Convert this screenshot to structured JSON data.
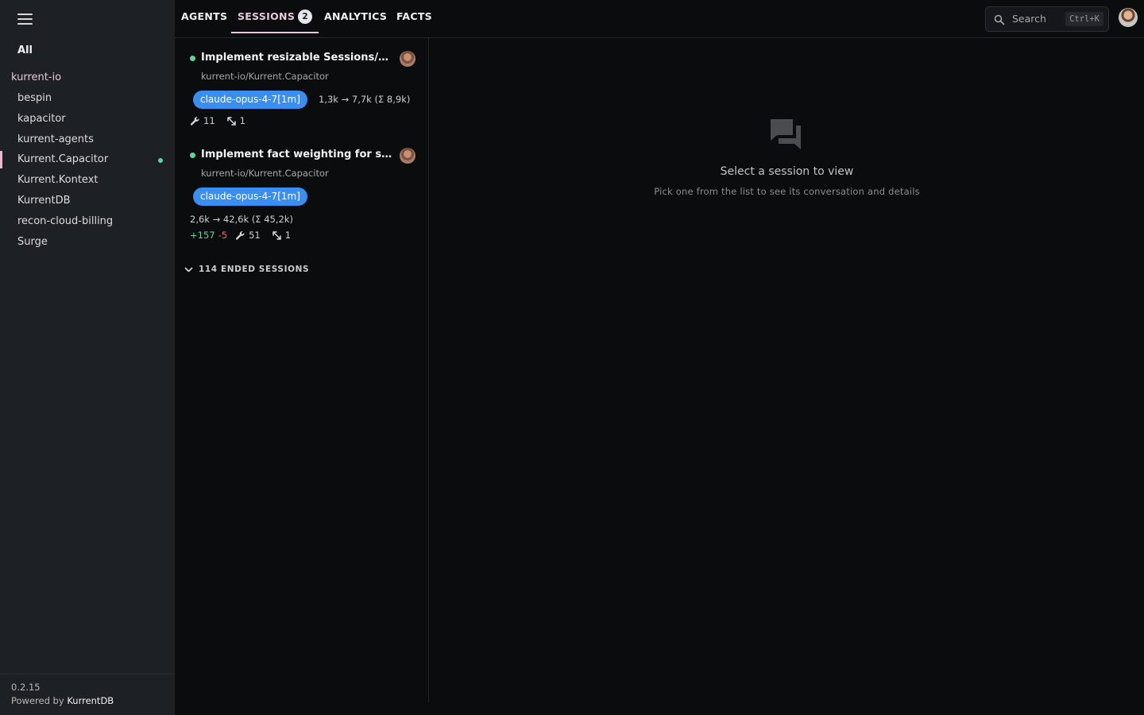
{
  "sidebar": {
    "all_label": "All",
    "org": "kurrent-io",
    "repos": [
      {
        "name": "bespin",
        "active": false,
        "dot": false
      },
      {
        "name": "kapacitor",
        "active": false,
        "dot": false
      },
      {
        "name": "kurrent-agents",
        "active": false,
        "dot": false
      },
      {
        "name": "Kurrent.Capacitor",
        "active": true,
        "dot": true
      },
      {
        "name": "Kurrent.Kontext",
        "active": false,
        "dot": false
      },
      {
        "name": "KurrentDB",
        "active": false,
        "dot": false
      },
      {
        "name": "recon-cloud-billing",
        "active": false,
        "dot": false
      },
      {
        "name": "Surge",
        "active": false,
        "dot": false
      }
    ],
    "version": "0.2.15",
    "powered_by": "Powered by",
    "powered_brand": "KurrentDB"
  },
  "tabs": {
    "agents": "AGENTS",
    "sessions": "SESSIONS",
    "sessions_count": "2",
    "analytics": "ANALYTICS",
    "facts": "FACTS"
  },
  "search": {
    "placeholder": "Search",
    "shortcut": "Ctrl+K"
  },
  "sessions": [
    {
      "title": "Implement resizable Sessions/Ag...",
      "repo": "kurrent-io/Kurrent.Capacitor",
      "model": "claude-opus-4-7[1m]",
      "tokens": "1,3k → 7,7k (Σ 8,9k)",
      "additions": "",
      "deletions": "",
      "tool_calls": "11",
      "subagents": "1"
    },
    {
      "title": "Implement fact weighting for self...",
      "repo": "kurrent-io/Kurrent.Capacitor",
      "model": "claude-opus-4-7[1m]",
      "tokens": "2,6k → 42,6k (Σ 45,2k)",
      "additions": "+157",
      "deletions": "-5",
      "tool_calls": "51",
      "subagents": "1"
    }
  ],
  "ended_sessions_label": "114 ENDED SESSIONS",
  "empty_state": {
    "title": "Select a session to view",
    "subtitle": "Pick one from the list to see its conversation and details"
  },
  "colors": {
    "accent": "#e9c8de",
    "active_dot": "#5fd3a0",
    "model_pill": "#3a8ef0",
    "deletions": "#e26d6d"
  }
}
